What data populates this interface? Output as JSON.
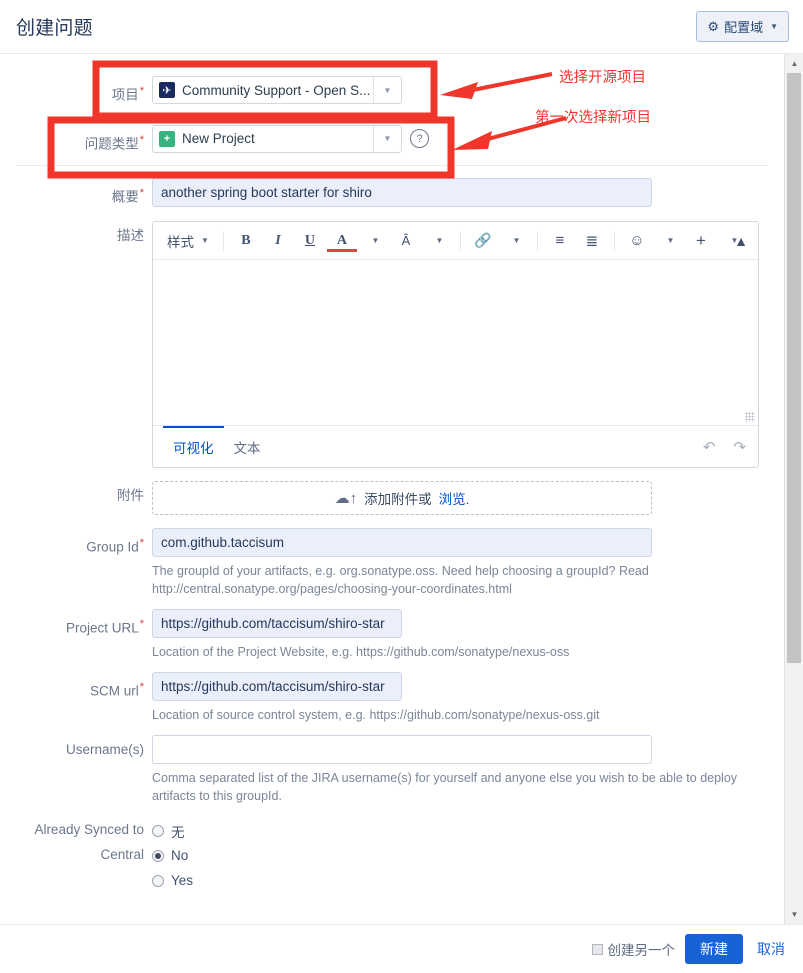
{
  "header": {
    "title": "创建问题",
    "config_button": {
      "label": "配置域",
      "icon": "gear-icon",
      "caret": "▼"
    }
  },
  "form": {
    "project": {
      "label": "项目",
      "required": "*",
      "value": "Community Support - Open S...",
      "icon": "rocket-icon",
      "icon_glyph": "🚀"
    },
    "issue_type": {
      "label": "问题类型",
      "required": "*",
      "value": "New Project",
      "icon": "plus-square-icon",
      "icon_glyph": "+",
      "help_icon": "?"
    },
    "summary": {
      "label": "概要",
      "required": "*",
      "value": "another spring boot starter for shiro",
      "placeholder": ""
    },
    "description": {
      "label": "描述",
      "toolbar": {
        "styles": "样式",
        "bold": "B",
        "italic": "I",
        "underline": "U",
        "text_color": "A",
        "more_color_caret": "⌄",
        "highlight": "A",
        "link": "🔗",
        "bullet_list": "☰",
        "numbered_list": "☷",
        "emoji": "☺",
        "insert_more": "+",
        "collapse": "⌃⌃"
      },
      "tabs": [
        {
          "label": "可视化",
          "active": true
        },
        {
          "label": "文本",
          "active": false
        }
      ],
      "undo": "↶",
      "redo": "↷",
      "content": ""
    },
    "attachment": {
      "label": "附件",
      "drop_text": "添加附件或",
      "browse_link": "浏览.",
      "icon": "cloud-upload-icon"
    },
    "group_id": {
      "label": "Group Id",
      "required": "*",
      "value": "com.github.taccisum",
      "help": "The groupId of your artifacts, e.g. org.sonatype.oss. Need help choosing a groupId? Read http://central.sonatype.org/pages/choosing-your-coordinates.html"
    },
    "project_url": {
      "label": "Project URL",
      "required": "*",
      "value": "https://github.com/taccisum/shiro-star",
      "help": "Location of the Project Website, e.g. https://github.com/sonatype/nexus-oss"
    },
    "scm_url": {
      "label": "SCM url",
      "required": "*",
      "value": "https://github.com/taccisum/shiro-star",
      "help": "Location of source control system, e.g. https://github.com/sonatype/nexus-oss.git"
    },
    "usernames": {
      "label": "Username(s)",
      "value": "",
      "placeholder": "",
      "help": "Comma separated list of the JIRA username(s) for yourself and anyone else you wish to be able to deploy artifacts to this groupId."
    },
    "already_synced": {
      "label": "Already Synced to Central",
      "label_line1": "Already Synced to",
      "label_line2": "Central",
      "options": [
        {
          "label": "无",
          "selected": false
        },
        {
          "label": "No",
          "selected": true
        },
        {
          "label": "Yes",
          "selected": false
        }
      ]
    }
  },
  "footer": {
    "create_another_label": "创建另一个",
    "create_another_checked": false,
    "submit_label": "新建",
    "cancel_label": "取消"
  },
  "annotations": [
    {
      "text": "选择开源项目",
      "color": "#f0352b"
    },
    {
      "text": "第一次选择新项目",
      "color": "#f0352b"
    }
  ],
  "colors": {
    "annotation_red": "#f0352b",
    "primary_blue": "#1763d6",
    "link_blue": "#0052cc",
    "label_gray": "#6b778c",
    "field_bg": "#eaeffb"
  },
  "scrollbar": {
    "up_arrow": "▲",
    "down_arrow": "▼"
  }
}
